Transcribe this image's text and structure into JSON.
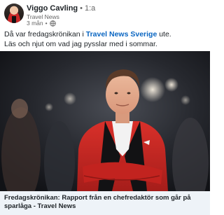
{
  "post": {
    "author": {
      "name": "Viggo Cavling",
      "degree": "1:a",
      "headline": "Travel News"
    },
    "time": "3 mån",
    "text": {
      "prefix": "Då var fredagskrönikan i ",
      "mention": "Travel News Sverige",
      "suffix": " ute.",
      "line2": "Läs och njut om vad jag pysslar med i sommar."
    },
    "link_card": {
      "title_line1": "Fredagskrönikan: Rapport från en chefredaktör som går på",
      "title_line2": "sparlåga - Travel News"
    }
  },
  "icons": {
    "visibility": "globe-icon"
  },
  "colors": {
    "mention": "#0a66c2",
    "jacket": "#c62828",
    "card_bg": "#eef3f8"
  }
}
